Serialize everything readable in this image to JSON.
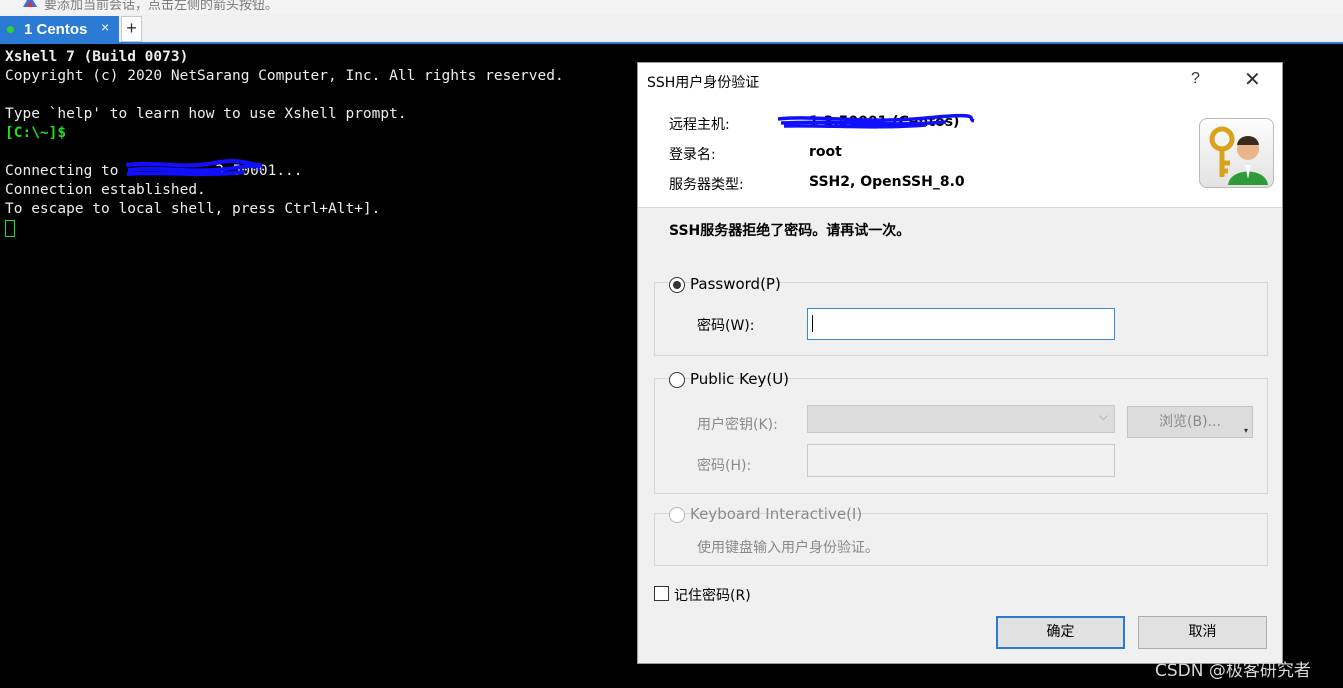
{
  "hint_bar": {
    "text": "要添加当前会话，点击左侧的箭头按钮。",
    "icon": "arrow-icon"
  },
  "tab_bar": {
    "tabs": [
      {
        "label": "1 Centos",
        "status_color": "#2fd32f",
        "close": "×"
      }
    ],
    "add_label": "+"
  },
  "terminal": {
    "lines": [
      "Xshell 7 (Build 0073)",
      "Copyright (c) 2020 NetSarang Computer, Inc. All rights reserved.",
      "",
      "Type `help' to learn how to use Xshell prompt.",
      "[C:\\~]$",
      "",
      "Connecting to ",
      "Connection established.",
      "To escape to local shell, press Ctrl+Alt+]."
    ],
    "connecting_suffix": "3.50001...",
    "colors": {
      "background": "#000000",
      "text": "#ededed",
      "prompt": "#1ee01e"
    }
  },
  "dialog": {
    "title": "SSH用户身份验证",
    "help": "?",
    "close": "✕",
    "info": {
      "remote_host_label": "远程主机:",
      "remote_host_value": "1 3.50001 (Centos)",
      "login_label": "登录名:",
      "login_value": "root",
      "server_type_label": "服务器类型:",
      "server_type_value": "SSH2, OpenSSH_8.0"
    },
    "error_message": "SSH服务器拒绝了密码。请再试一次。",
    "password_group": {
      "radio_label": "Password(P)",
      "field_label": "密码(W):",
      "value": "",
      "selected": true
    },
    "pubkey_group": {
      "radio_label": "Public Key(U)",
      "user_key_label": "用户密钥(K):",
      "browse_label": "浏览(B)...",
      "passphrase_label": "密码(H):"
    },
    "keyboard_group": {
      "radio_label": "Keyboard Interactive(I)",
      "description": "使用键盘输入用户身份验证。"
    },
    "remember_password": {
      "label": "记住密码(R)",
      "checked": false
    },
    "ok_label": "确定",
    "cancel_label": "取消",
    "accent_color": "#2b7bd4"
  },
  "watermark": "CSDN @极客研究者"
}
